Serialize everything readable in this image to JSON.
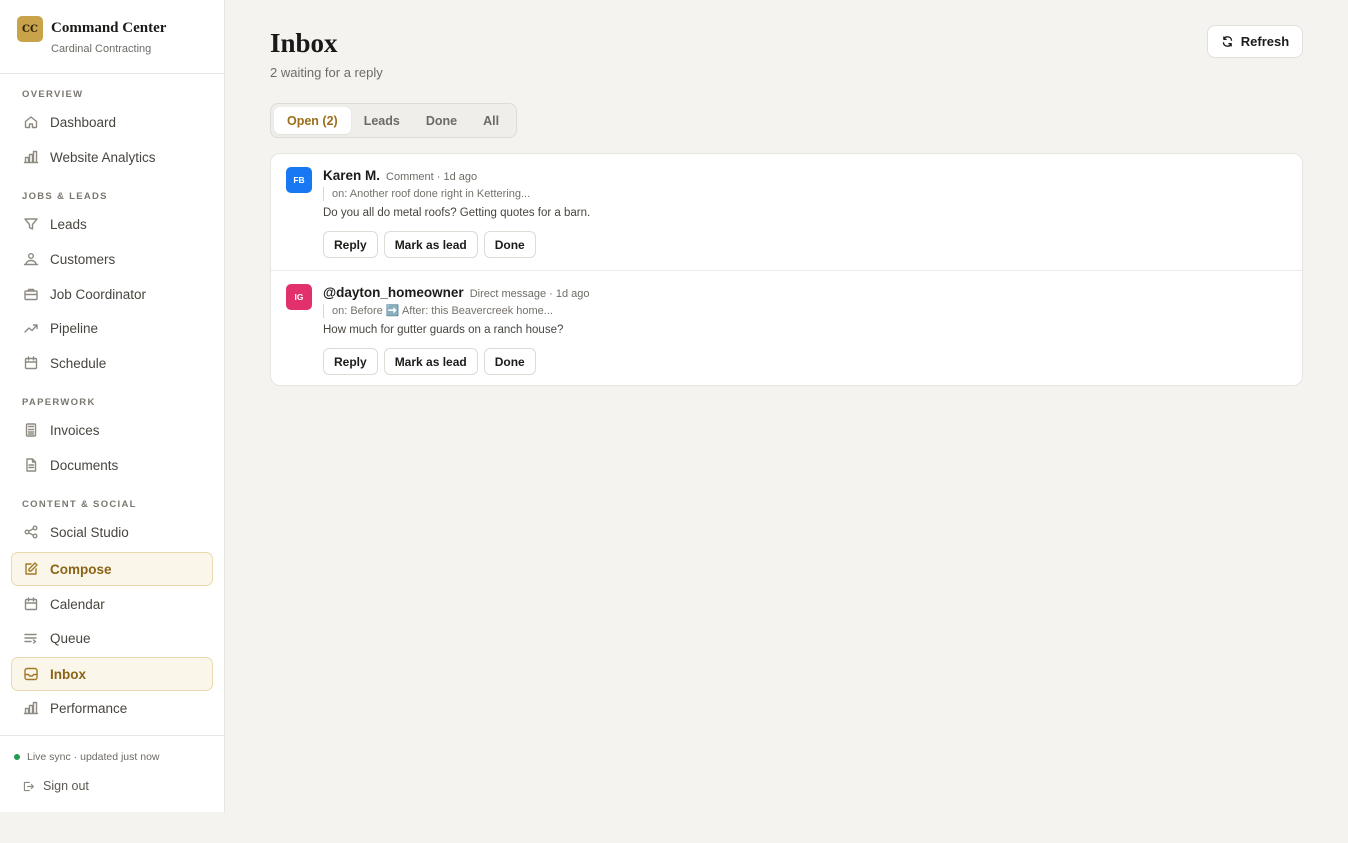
{
  "brand": {
    "logo": "CC",
    "title": "Command Center",
    "subtitle": "Cardinal Contracting"
  },
  "sidebar": {
    "sections": [
      {
        "label": "OVERVIEW"
      },
      {
        "label": "JOBS & LEADS"
      },
      {
        "label": "PAPERWORK"
      },
      {
        "label": "CONTENT & SOCIAL"
      }
    ],
    "items": [
      {
        "label": "Dashboard",
        "icon": "home-icon"
      },
      {
        "label": "Website Analytics",
        "icon": "bar-chart-icon"
      },
      {
        "label": "Leads",
        "icon": "funnel-icon"
      },
      {
        "label": "Customers",
        "icon": "users-icon"
      },
      {
        "label": "Job Coordinator",
        "icon": "briefcase-icon"
      },
      {
        "label": "Pipeline",
        "icon": "trend-icon"
      },
      {
        "label": "Schedule",
        "icon": "calendar-icon"
      },
      {
        "label": "Invoices",
        "icon": "calculator-icon"
      },
      {
        "label": "Documents",
        "icon": "document-icon"
      },
      {
        "label": "Social Studio",
        "icon": "share-icon"
      },
      {
        "label": "Compose",
        "icon": "edit-icon"
      },
      {
        "label": "Calendar",
        "icon": "calendar-icon"
      },
      {
        "label": "Queue",
        "icon": "queue-icon"
      },
      {
        "label": "Inbox",
        "icon": "inbox-icon"
      },
      {
        "label": "Performance",
        "icon": "bar-chart-icon"
      }
    ],
    "sync_text": "Live sync · updated just now",
    "sign_out": "Sign out"
  },
  "colors": {
    "accent": "#c9a34a",
    "facebook": "#1877f2",
    "instagram": "#e1306c",
    "live": "#1f9d55"
  },
  "page": {
    "title": "Inbox",
    "subtitle": "2 waiting for a reply",
    "refresh_label": "Refresh"
  },
  "tabs": [
    {
      "label": "Open (2)"
    },
    {
      "label": "Leads"
    },
    {
      "label": "Done"
    },
    {
      "label": "All"
    }
  ],
  "messages": [
    {
      "platform": "FB",
      "author": "Karen M.",
      "meta": "Comment · 1d ago",
      "context": "on: Another roof done right in Kettering...",
      "text": "Do you all do metal roofs? Getting quotes for a barn.",
      "actions": [
        "Reply",
        "Mark as lead",
        "Done"
      ]
    },
    {
      "platform": "IG",
      "author": "@dayton_homeowner",
      "meta": "Direct message · 1d ago",
      "context": "on: Before ➡️ After: this Beavercreek home...",
      "text": "How much for gutter guards on a ranch house?",
      "actions": [
        "Reply",
        "Mark as lead",
        "Done"
      ]
    }
  ]
}
